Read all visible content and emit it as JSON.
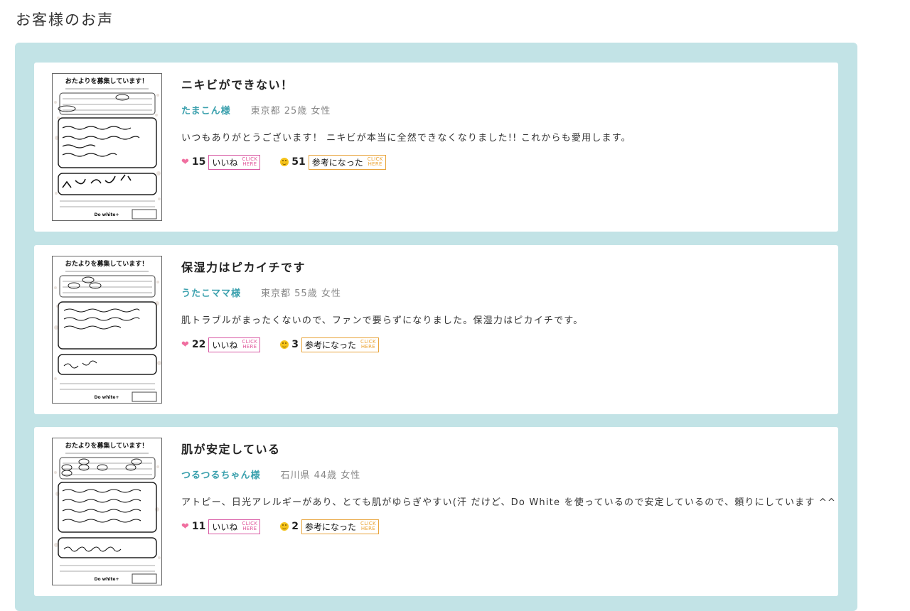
{
  "page": {
    "title": "お客様のお声"
  },
  "thumbnail": {
    "form_title": "おたよりを募集しています！",
    "brand": "Do white+"
  },
  "buttons": {
    "like_label": "いいね",
    "helpful_label": "参考になった",
    "click_here_line1": "CLICK",
    "click_here_line2": "HERE"
  },
  "icons": {
    "like": "heart-icon",
    "helpful": "smile-icon"
  },
  "colors": {
    "panel_bg": "#c2e3e6",
    "name_accent": "#3aa0ad",
    "like_accent": "#d85aa4",
    "helpful_accent": "#e8a43c"
  },
  "reviews": [
    {
      "title": "ニキビができない！",
      "name": "たまこん様",
      "info": "東京都 25歳 女性",
      "body": "いつもありがとうございます！ ニキビが本当に全然できなくなりました!! これからも愛用します。",
      "likes": "15",
      "helpful": "51"
    },
    {
      "title": "保湿力はピカイチです",
      "name": "うたこママ様",
      "info": "東京都 55歳 女性",
      "body": "肌トラブルがまったくないので、ファンで要らずになりました。保湿力はピカイチです。",
      "likes": "22",
      "helpful": "3"
    },
    {
      "title": "肌が安定している",
      "name": "つるつるちゃん様",
      "info": "石川県 44歳 女性",
      "body": "アトピー、日光アレルギーがあり、とても肌がゆらぎやすい(汗 だけど、Do White を使っているので安定しているので、頼りにしています ^^",
      "likes": "11",
      "helpful": "2"
    }
  ]
}
